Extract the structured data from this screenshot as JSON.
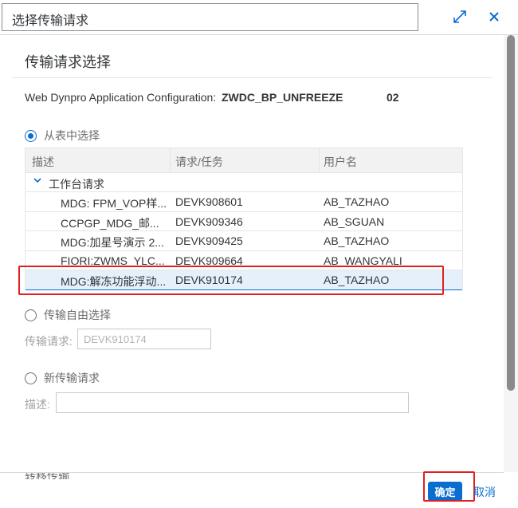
{
  "dialog": {
    "title": "选择传输请求",
    "icons": [
      "expand-icon",
      "close-icon"
    ]
  },
  "section": {
    "title": "传输请求选择",
    "config_label": "Web Dynpro Application Configuration:",
    "config_value": "ZWDC_BP_UNFREEZE",
    "config_version": "02"
  },
  "options": {
    "from_table": "从表中选择",
    "free_select": "传输自由选择",
    "new_request": "新传输请求"
  },
  "table": {
    "headers": [
      "描述",
      "请求/任务",
      "用户名"
    ],
    "group": "工作台请求",
    "rows": [
      {
        "desc": "MDG: FPM_VOP样...",
        "request": "DEVK908601",
        "user": "AB_TAZHAO"
      },
      {
        "desc": "CCPGP_MDG_邮...",
        "request": "DEVK909346",
        "user": "AB_SGUAN"
      },
      {
        "desc": "MDG:加星号演示 2...",
        "request": "DEVK909425",
        "user": "AB_TAZHAO"
      },
      {
        "desc": "FIORI:ZWMS_YLC...",
        "request": "DEVK909664",
        "user": "AB_WANGYALI"
      },
      {
        "desc": "MDG:解冻功能浮动...",
        "request": "DEVK910174",
        "user": "AB_TAZHAO"
      }
    ]
  },
  "free_select": {
    "label": "传输请求:",
    "value": "DEVK910174"
  },
  "new_request": {
    "label": "描述:",
    "value": ""
  },
  "footer": {
    "hidden_label": "转移传输",
    "ok_label": "确定",
    "cancel_label": "取消"
  },
  "colors": {
    "accent": "#0a6ed1",
    "highlight": "#e02020",
    "selected_row": "#e5f0fa"
  }
}
